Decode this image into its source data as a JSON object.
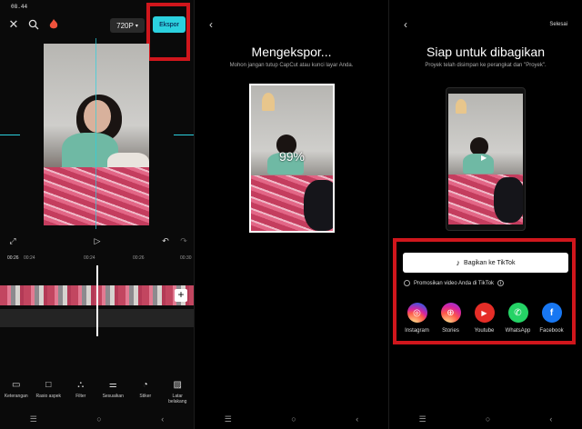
{
  "panel1": {
    "status_time": "08.44",
    "resolution": "720P",
    "export_label": "Ekspor",
    "time_left": "00:26",
    "time_total": "00:24",
    "ticks": [
      "00:24",
      "00:26",
      "00:30"
    ],
    "tools": [
      {
        "icon": "caption-icon",
        "label": "Keterangan"
      },
      {
        "icon": "aspect-ratio-icon",
        "label": "Rasio aspek"
      },
      {
        "icon": "filter-icon",
        "label": "Filter"
      },
      {
        "icon": "adjust-icon",
        "label": "Sesuaikan"
      },
      {
        "icon": "sticker-icon",
        "label": "Stiker"
      },
      {
        "icon": "background-icon",
        "label": "Latar belakang"
      }
    ]
  },
  "panel2": {
    "title": "Mengekspor...",
    "subtitle": "Mohon jangan tutup CapCut atau kunci layar Anda.",
    "progress": "99%"
  },
  "panel3": {
    "done_label": "Selesai",
    "title": "Siap untuk dibagikan",
    "subtitle": "Proyek telah disimpan ke perangkat dan \"Proyek\".",
    "share_tiktok": "Bagikan ke TikTok",
    "promo_label": "Promosikan video Anda di TikTok",
    "apps": [
      {
        "name": "Instagram",
        "color": "#c13584"
      },
      {
        "name": "Stories",
        "color": "#e1306c"
      },
      {
        "name": "Youtube",
        "color": "#e52d27"
      },
      {
        "name": "WhatsApp",
        "color": "#25d366"
      },
      {
        "name": "Facebook",
        "color": "#1877f2"
      }
    ]
  },
  "colors": {
    "accent": "#2bd1df",
    "highlight": "#d0161c"
  }
}
